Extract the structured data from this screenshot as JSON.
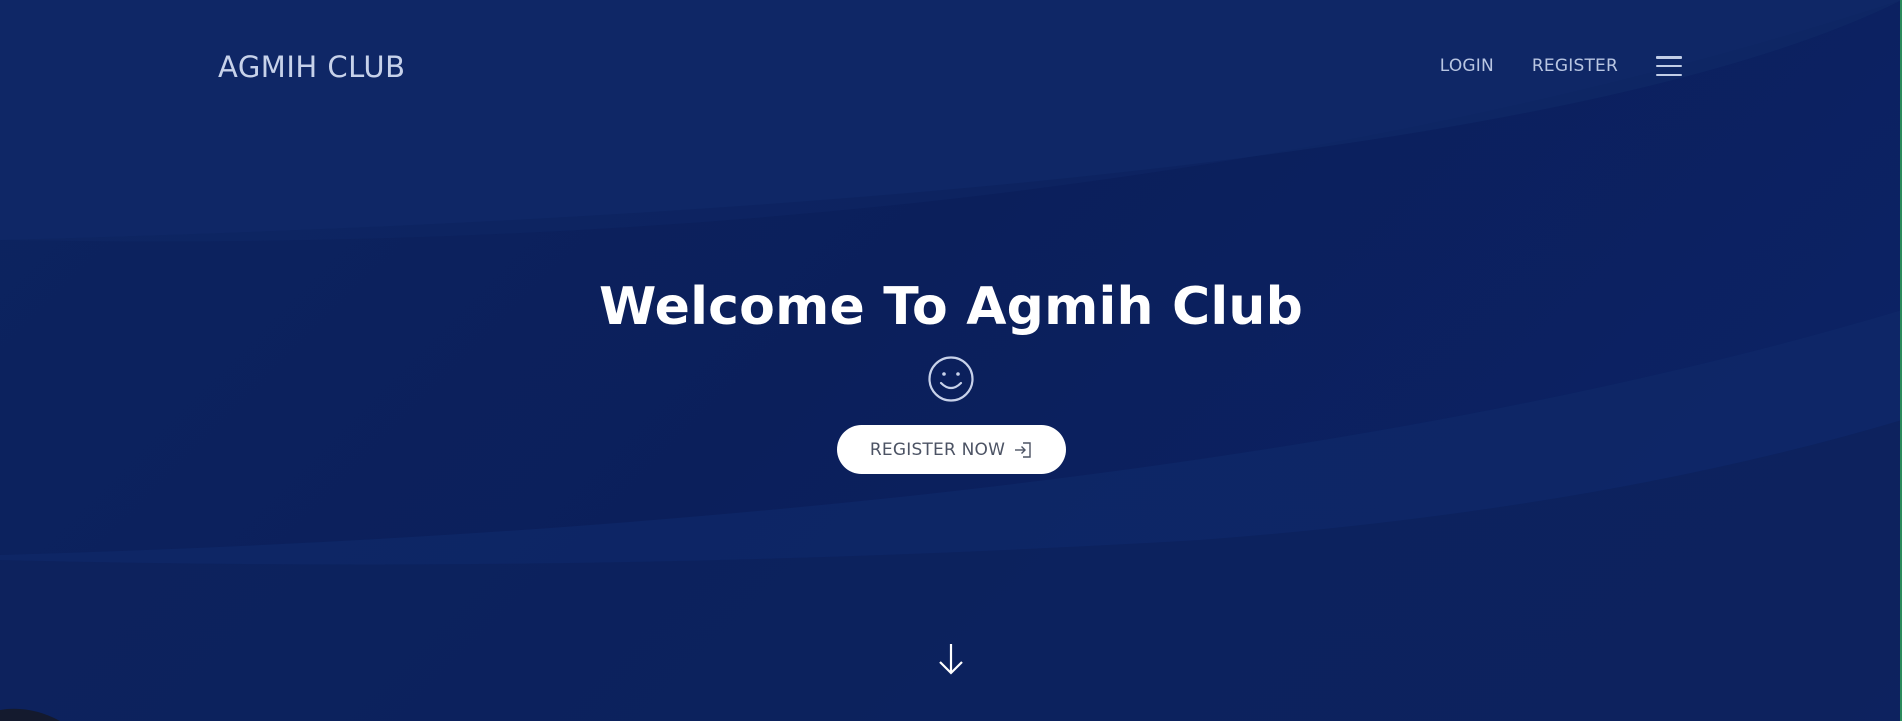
{
  "header": {
    "brand": "AGMIH CLUB",
    "nav": {
      "login_label": "LOGIN",
      "register_label": "REGISTER",
      "menu_icon": "hamburger-menu-icon"
    }
  },
  "hero": {
    "title": "Welcome To Agmih Club",
    "emoji_icon": "smiley-face-icon",
    "cta_label": "REGISTER NOW",
    "cta_icon": "sign-in-icon",
    "scroll_icon": "arrow-down-icon"
  },
  "colors": {
    "background": "#0b1f5c",
    "brand_text": "#c7d2ea",
    "title_text": "#ffffff",
    "button_bg": "#ffffff",
    "button_text": "#4c5364"
  }
}
